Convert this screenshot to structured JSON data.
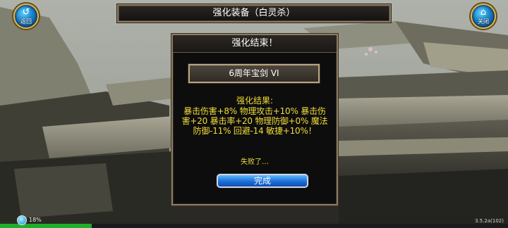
{
  "header": {
    "title": "强化装备（白灵杀）",
    "back_button": {
      "label": "返回",
      "icon": "back-arrow-icon"
    },
    "close_button": {
      "label": "关闭",
      "icon": "home-icon"
    }
  },
  "dialog": {
    "title": "强化结束！",
    "item_name": "6周年宝剑 VI",
    "result_heading": "强化结果:",
    "result_lines": [
      "暴击伤害+8% 物理攻击+10% 暴击伤",
      "害+20 暴击率+20 物理防御+0% 魔法",
      "防御-11% 回避-14 敏捷+10%！"
    ],
    "status_text": "失败了…",
    "confirm_label": "完成"
  },
  "status_bar": {
    "progress_percent_label": "18%",
    "progress_fraction": 0.18,
    "version": "3.5.2a(102)"
  },
  "colors": {
    "result_text": "#f2dc3a",
    "button_blue": "#1a6fd8",
    "frame_gold": "#8e7c60",
    "progress_green": "#1fae2a"
  }
}
